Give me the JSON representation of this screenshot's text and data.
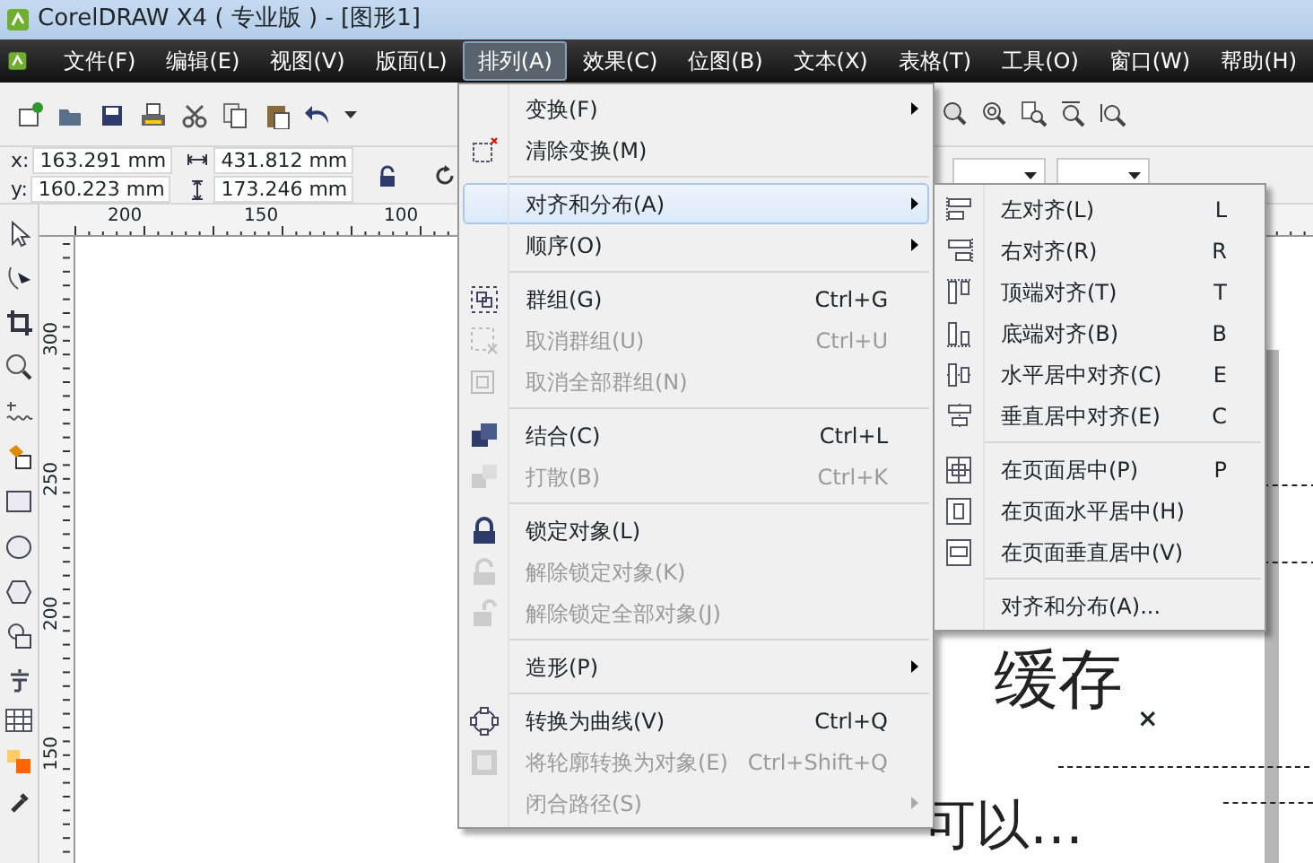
{
  "window": {
    "title": "CorelDRAW X4 ( 专业版 ) - [图形1]"
  },
  "menubar": [
    {
      "label": "文件(F)",
      "selected": false
    },
    {
      "label": "编辑(E)",
      "selected": false
    },
    {
      "label": "视图(V)",
      "selected": false
    },
    {
      "label": "版面(L)",
      "selected": false
    },
    {
      "label": "排列(A)",
      "selected": true
    },
    {
      "label": "效果(C)",
      "selected": false
    },
    {
      "label": "位图(B)",
      "selected": false
    },
    {
      "label": "文本(X)",
      "selected": false
    },
    {
      "label": "表格(T)",
      "selected": false
    },
    {
      "label": "工具(O)",
      "selected": false
    },
    {
      "label": "窗口(W)",
      "selected": false
    },
    {
      "label": "帮助(H)",
      "selected": false
    }
  ],
  "property_bar": {
    "x_label": "x:",
    "x": "163.291 mm",
    "y_label": "y:",
    "y": "160.223 mm",
    "width": "431.812 mm",
    "height": "173.246 mm"
  },
  "rulers": {
    "horizontal": [
      "200",
      "150",
      "100"
    ],
    "vertical": [
      "300",
      "250",
      "200",
      "150"
    ]
  },
  "arrange_menu": [
    {
      "kind": "item",
      "label": "变换(F)",
      "submenu": true,
      "disabled": false,
      "selected": false
    },
    {
      "kind": "item",
      "label": "清除变换(M)",
      "submenu": false,
      "disabled": false,
      "selected": false
    },
    {
      "kind": "separator"
    },
    {
      "kind": "item",
      "label": "对齐和分布(A)",
      "submenu": true,
      "disabled": false,
      "selected": true
    },
    {
      "kind": "item",
      "label": "顺序(O)",
      "submenu": true,
      "disabled": false,
      "selected": false
    },
    {
      "kind": "separator"
    },
    {
      "kind": "item",
      "label": "群组(G)",
      "shortcut": "Ctrl+G",
      "submenu": false,
      "disabled": false,
      "selected": false
    },
    {
      "kind": "item",
      "label": "取消群组(U)",
      "shortcut": "Ctrl+U",
      "submenu": false,
      "disabled": true,
      "selected": false
    },
    {
      "kind": "item",
      "label": "取消全部群组(N)",
      "submenu": false,
      "disabled": true,
      "selected": false
    },
    {
      "kind": "separator"
    },
    {
      "kind": "item",
      "label": "结合(C)",
      "shortcut": "Ctrl+L",
      "submenu": false,
      "disabled": false,
      "selected": false
    },
    {
      "kind": "item",
      "label": "打散(B)",
      "shortcut": "Ctrl+K",
      "submenu": false,
      "disabled": true,
      "selected": false
    },
    {
      "kind": "separator"
    },
    {
      "kind": "item",
      "label": "锁定对象(L)",
      "submenu": false,
      "disabled": false,
      "selected": false
    },
    {
      "kind": "item",
      "label": "解除锁定对象(K)",
      "submenu": false,
      "disabled": true,
      "selected": false
    },
    {
      "kind": "item",
      "label": "解除锁定全部对象(J)",
      "submenu": false,
      "disabled": true,
      "selected": false
    },
    {
      "kind": "separator"
    },
    {
      "kind": "item",
      "label": "造形(P)",
      "submenu": true,
      "disabled": false,
      "selected": false
    },
    {
      "kind": "separator"
    },
    {
      "kind": "item",
      "label": "转换为曲线(V)",
      "shortcut": "Ctrl+Q",
      "submenu": false,
      "disabled": false,
      "selected": false
    },
    {
      "kind": "item",
      "label": "将轮廓转换为对象(E)",
      "shortcut": "Ctrl+Shift+Q",
      "submenu": false,
      "disabled": true,
      "selected": false
    },
    {
      "kind": "item",
      "label": "闭合路径(S)",
      "submenu": true,
      "disabled": true,
      "selected": false
    }
  ],
  "align_submenu": [
    {
      "kind": "item",
      "label": "左对齐(L)",
      "shortcut": "L"
    },
    {
      "kind": "item",
      "label": "右对齐(R)",
      "shortcut": "R"
    },
    {
      "kind": "item",
      "label": "顶端对齐(T)",
      "shortcut": "T"
    },
    {
      "kind": "item",
      "label": "底端对齐(B)",
      "shortcut": "B"
    },
    {
      "kind": "item",
      "label": "水平居中对齐(C)",
      "shortcut": "E"
    },
    {
      "kind": "item",
      "label": "垂直居中对齐(E)",
      "shortcut": "C"
    },
    {
      "kind": "separator"
    },
    {
      "kind": "item",
      "label": "在页面居中(P)",
      "shortcut": "P"
    },
    {
      "kind": "item",
      "label": "在页面水平居中(H)"
    },
    {
      "kind": "item",
      "label": "在页面垂直居中(V)"
    },
    {
      "kind": "separator"
    },
    {
      "kind": "item",
      "label": "对齐和分布(A)..."
    }
  ],
  "canvas": {
    "large_text": "缓存",
    "close_mark": "×",
    "bottom_text": "可以…"
  }
}
